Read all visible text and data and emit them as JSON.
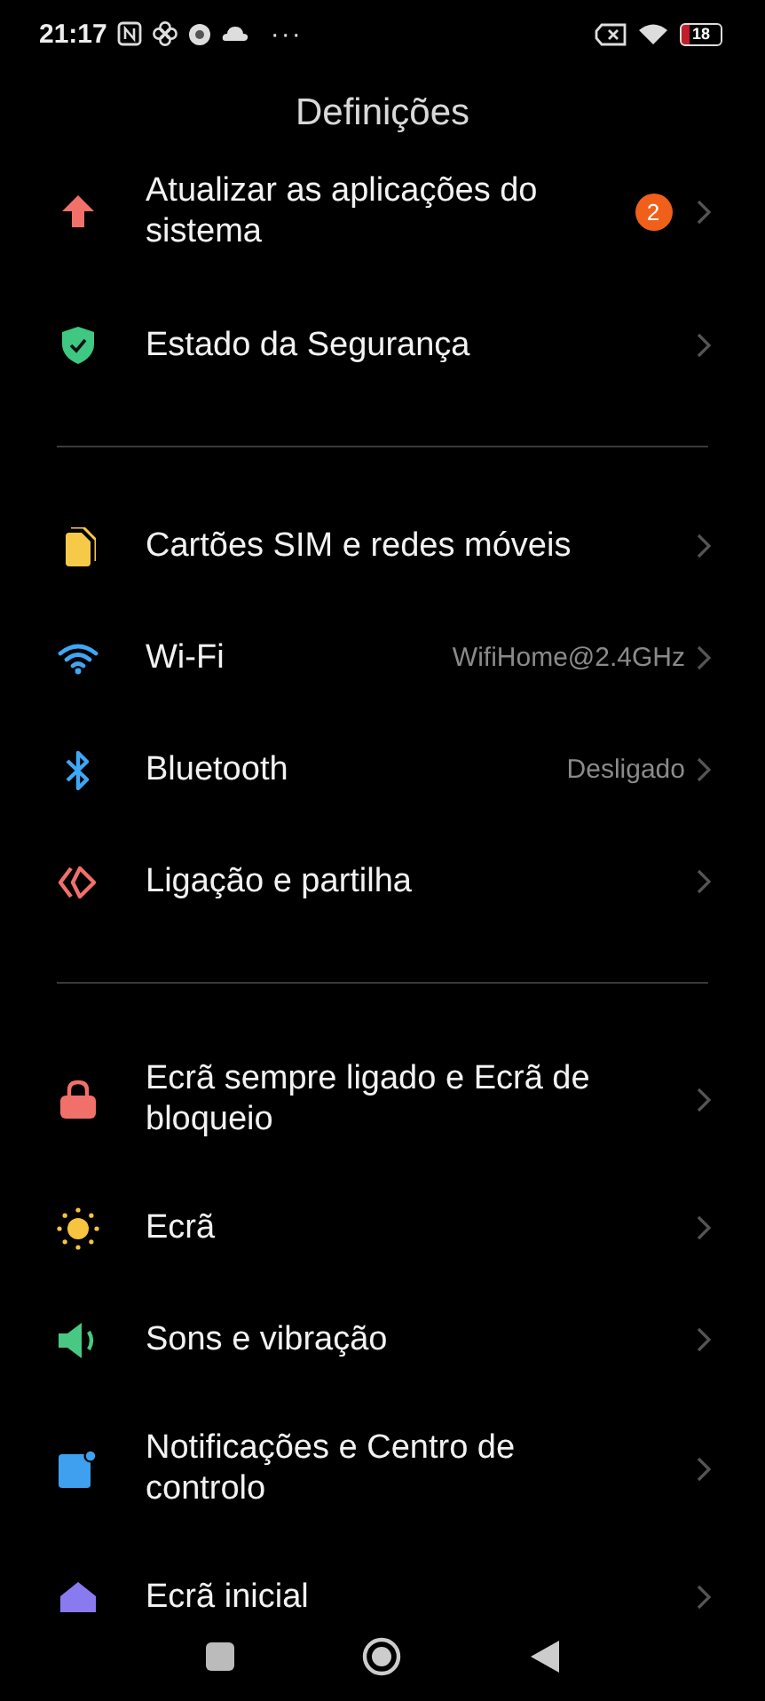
{
  "status_bar": {
    "time": "21:17",
    "more": "···",
    "battery": "18"
  },
  "title": "Definições",
  "sections": [
    {
      "items": [
        {
          "label": "Atualizar as aplicações do sistema",
          "badge": "2"
        },
        {
          "label": "Estado da Segurança"
        }
      ]
    },
    {
      "items": [
        {
          "label": "Cartões SIM e redes móveis"
        },
        {
          "label": "Wi-Fi",
          "value": "WifiHome@2.4GHz"
        },
        {
          "label": "Bluetooth",
          "value": "Desligado"
        },
        {
          "label": "Ligação e partilha"
        }
      ]
    },
    {
      "items": [
        {
          "label": "Ecrã sempre ligado e Ecrã de bloqueio"
        },
        {
          "label": "Ecrã"
        },
        {
          "label": "Sons e vibração"
        },
        {
          "label": "Notificações e Centro de controlo"
        },
        {
          "label": "Ecrã inicial"
        }
      ]
    }
  ]
}
